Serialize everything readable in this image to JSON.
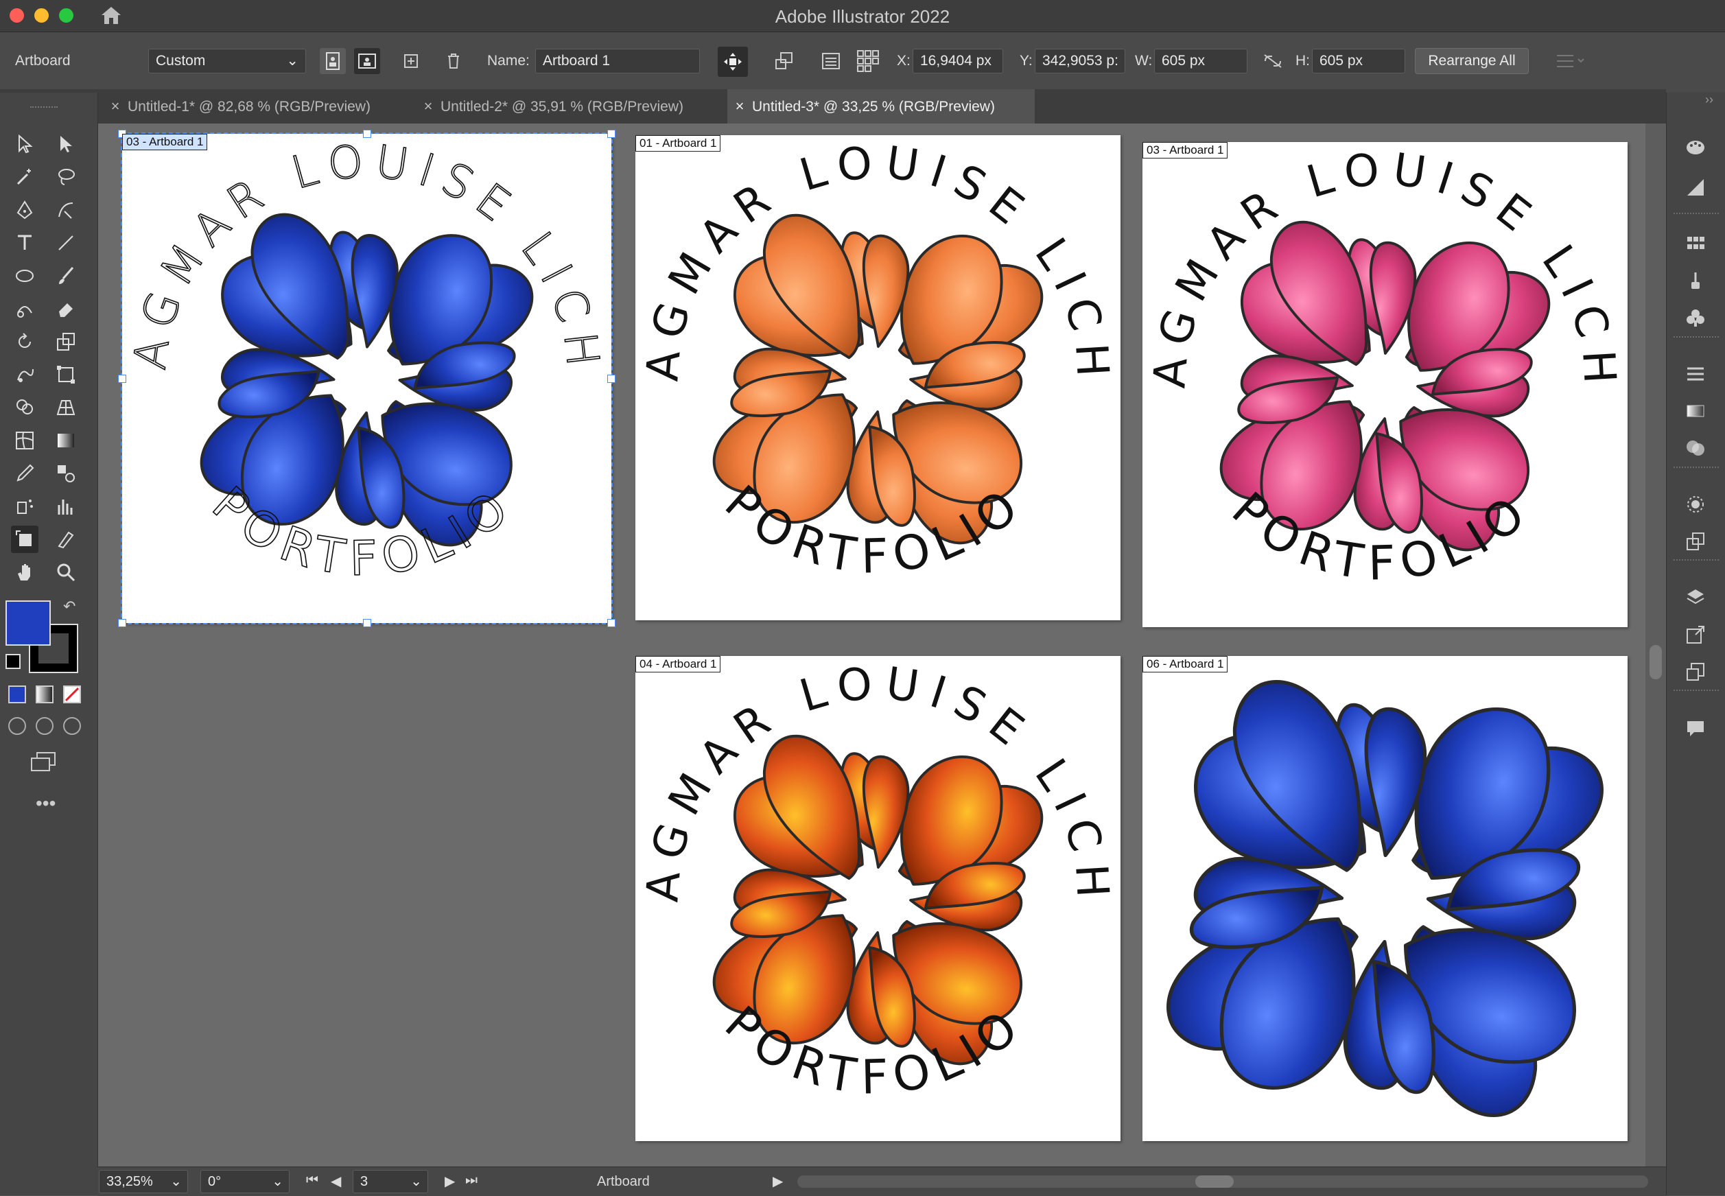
{
  "app": {
    "title": "Adobe Illustrator 2022"
  },
  "control_bar": {
    "mode_label": "Artboard",
    "preset_value": "Custom",
    "name_label": "Name:",
    "name_value": "Artboard 1",
    "x_label": "X:",
    "x_value": "16,9404 px",
    "y_label": "Y:",
    "y_value": "342,9053 p:",
    "w_label": "W:",
    "w_value": "605 px",
    "h_label": "H:",
    "h_value": "605 px",
    "rearrange_label": "Rearrange All"
  },
  "tabs": [
    {
      "label": "Untitled-1* @ 82,68 % (RGB/Preview)",
      "active": false
    },
    {
      "label": "Untitled-2* @ 35,91 % (RGB/Preview)",
      "active": false
    },
    {
      "label": "Untitled-3* @ 33,25 % (RGB/Preview)",
      "active": true
    }
  ],
  "artboards": [
    {
      "label": "03 - Artboard 1",
      "selected": true,
      "color": "#1f3fbf",
      "highlight": "#5c85ff",
      "outline": "#0c1a66",
      "text_style": "thin"
    },
    {
      "label": "01 - Artboard 1",
      "selected": false,
      "color": "#f07d3c",
      "highlight": "#ffb27a",
      "outline": "#a74b17",
      "text_style": "bold"
    },
    {
      "label": "03 - Artboard 1",
      "selected": false,
      "color": "#d9407d",
      "highlight": "#ff8fba",
      "outline": "#8e1f4a",
      "text_style": "bold"
    },
    {
      "label": "04 - Artboard 1",
      "selected": false,
      "color": "#e2531a",
      "highlight": "#ffc02a",
      "outline": "#7a2200",
      "text_style": "bold"
    },
    {
      "label": "06 - Artboard 1",
      "selected": false,
      "color": "#1f3fbf",
      "highlight": "#5c85ff",
      "outline": "#0c1a66",
      "text_style": "none"
    }
  ],
  "logo": {
    "arc_text": "DAGMAR LOUISE LICHT",
    "bottom_text": "PORTFOLIO"
  },
  "colors": {
    "fill_swatch": "#1f3fbf",
    "stroke_swatch": "#000000",
    "selection": "#4b8df8"
  },
  "status_bar": {
    "zoom": "33,25%",
    "rotation": "0°",
    "artboard_number": "3",
    "mode": "Artboard"
  }
}
